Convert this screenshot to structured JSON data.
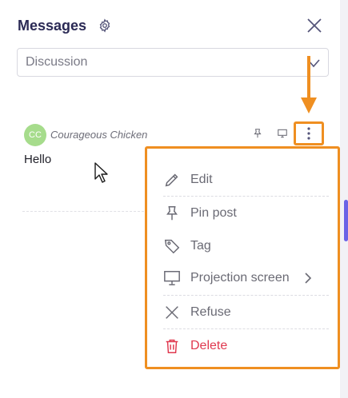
{
  "header": {
    "title": "Messages"
  },
  "filter": {
    "selected": "Discussion"
  },
  "message": {
    "avatar_initials": "CC",
    "author": "Courageous Chicken",
    "text": "Hello"
  },
  "context_menu": {
    "items": [
      {
        "label": "Edit",
        "icon": "pencil-icon"
      },
      {
        "label": "Pin post",
        "icon": "pin-icon"
      },
      {
        "label": "Tag",
        "icon": "tag-icon"
      },
      {
        "label": "Projection screen",
        "icon": "projector-icon",
        "submenu": true
      },
      {
        "label": "Refuse",
        "icon": "x-icon"
      },
      {
        "label": "Delete",
        "icon": "trash-icon",
        "danger": true
      }
    ]
  },
  "colors": {
    "highlight": "#ef8f21",
    "title": "#2b2a55",
    "avatar": "#a6dc8c",
    "danger": "#e0394f",
    "accent": "#6b63e6"
  }
}
